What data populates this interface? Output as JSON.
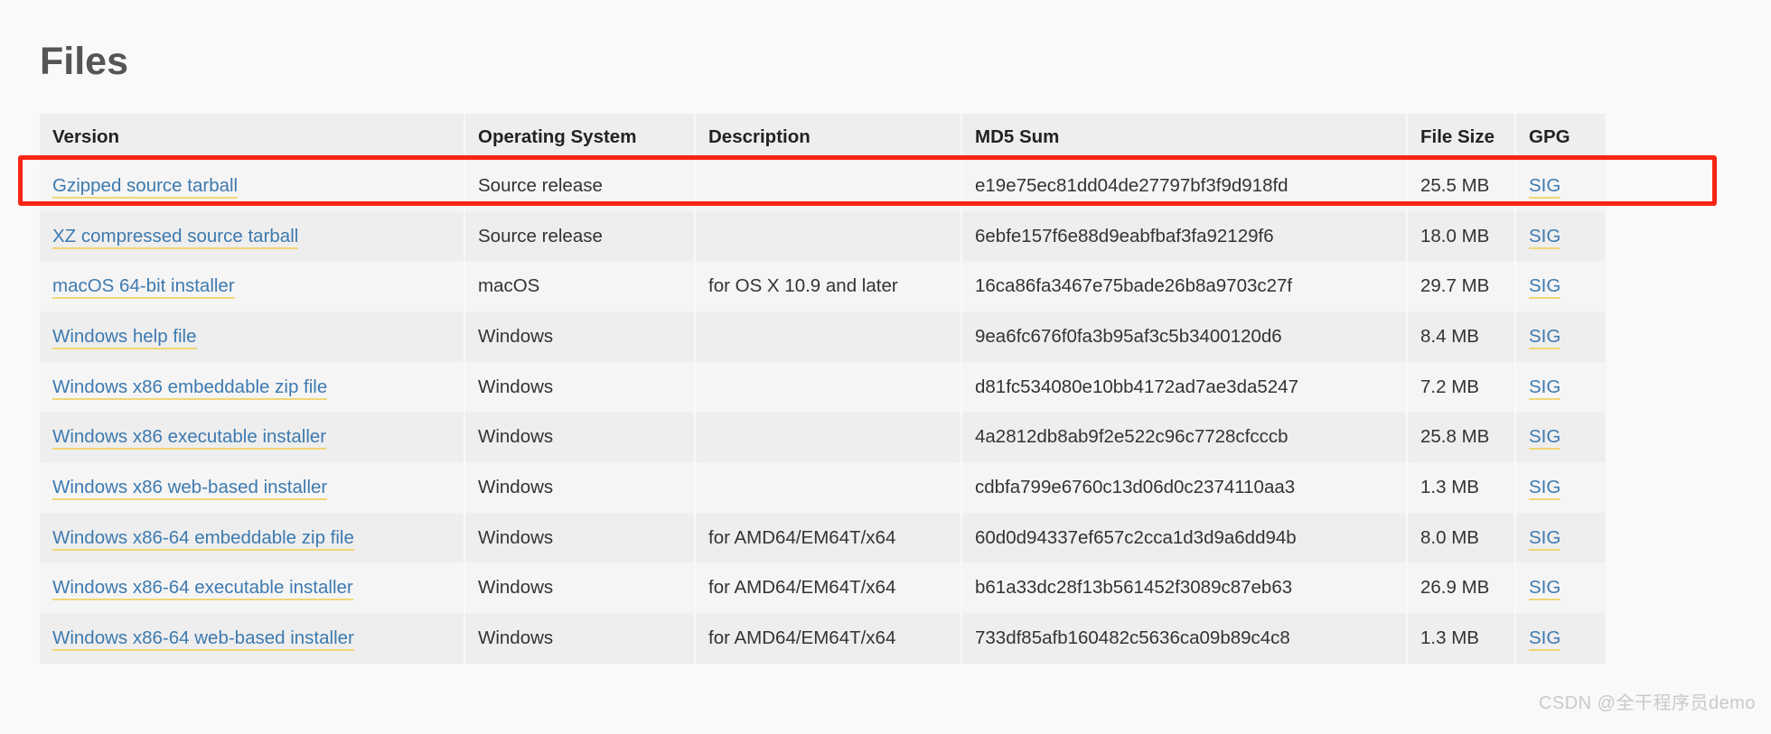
{
  "page": {
    "title": "Files",
    "watermark": "CSDN @全干程序员demo"
  },
  "colors": {
    "link": "#3d7ab0",
    "link_underline": "#f1d675",
    "highlight_border": "#fa2516",
    "header_bg": "#eeeeee",
    "row_odd_bg": "#f5f5f5",
    "row_even_bg": "#eeeeee",
    "page_bg": "#f9f9f9",
    "title_text": "#555555"
  },
  "table": {
    "columns": [
      "Version",
      "Operating System",
      "Description",
      "MD5 Sum",
      "File Size",
      "GPG"
    ],
    "rows": [
      {
        "version": "Gzipped source tarball",
        "os": "Source release",
        "description": "",
        "md5": "e19e75ec81dd04de27797bf3f9d918fd",
        "size": "25.5 MB",
        "gpg": "SIG",
        "highlighted": true
      },
      {
        "version": "XZ compressed source tarball",
        "os": "Source release",
        "description": "",
        "md5": "6ebfe157f6e88d9eabfbaf3fa92129f6",
        "size": "18.0 MB",
        "gpg": "SIG",
        "highlighted": false
      },
      {
        "version": "macOS 64-bit installer",
        "os": "macOS",
        "description": "for OS X 10.9 and later",
        "md5": "16ca86fa3467e75bade26b8a9703c27f",
        "size": "29.7 MB",
        "gpg": "SIG",
        "highlighted": false
      },
      {
        "version": "Windows help file",
        "os": "Windows",
        "description": "",
        "md5": "9ea6fc676f0fa3b95af3c5b3400120d6",
        "size": "8.4 MB",
        "gpg": "SIG",
        "highlighted": false
      },
      {
        "version": "Windows x86 embeddable zip file",
        "os": "Windows",
        "description": "",
        "md5": "d81fc534080e10bb4172ad7ae3da5247",
        "size": "7.2 MB",
        "gpg": "SIG",
        "highlighted": false
      },
      {
        "version": "Windows x86 executable installer",
        "os": "Windows",
        "description": "",
        "md5": "4a2812db8ab9f2e522c96c7728cfcccb",
        "size": "25.8 MB",
        "gpg": "SIG",
        "highlighted": false
      },
      {
        "version": "Windows x86 web-based installer",
        "os": "Windows",
        "description": "",
        "md5": "cdbfa799e6760c13d06d0c2374110aa3",
        "size": "1.3 MB",
        "gpg": "SIG",
        "highlighted": false
      },
      {
        "version": "Windows x86-64 embeddable zip file",
        "os": "Windows",
        "description": "for AMD64/EM64T/x64",
        "md5": "60d0d94337ef657c2cca1d3d9a6dd94b",
        "size": "8.0 MB",
        "gpg": "SIG",
        "highlighted": false
      },
      {
        "version": "Windows x86-64 executable installer",
        "os": "Windows",
        "description": "for AMD64/EM64T/x64",
        "md5": "b61a33dc28f13b561452f3089c87eb63",
        "size": "26.9 MB",
        "gpg": "SIG",
        "highlighted": false
      },
      {
        "version": "Windows x86-64 web-based installer",
        "os": "Windows",
        "description": "for AMD64/EM64T/x64",
        "md5": "733df85afb160482c5636ca09b89c4c8",
        "size": "1.3 MB",
        "gpg": "SIG",
        "highlighted": false
      }
    ]
  }
}
